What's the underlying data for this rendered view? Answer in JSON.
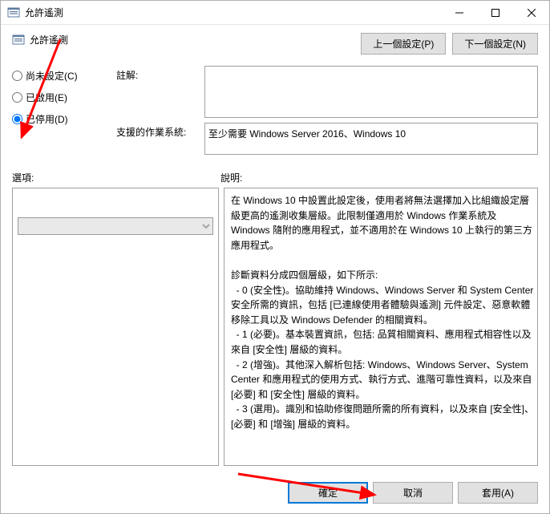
{
  "window": {
    "title": "允許遙測"
  },
  "header": {
    "policy_title": "允許遙測",
    "prev_button": "上一個設定(P)",
    "next_button": "下一個設定(N)"
  },
  "radios": {
    "not_configured": "尚未設定(C)",
    "enabled": "已啟用(E)",
    "disabled": "已停用(D)"
  },
  "fields": {
    "comment_label": "註解:",
    "comment_value": "",
    "os_label": "支援的作業系統:",
    "os_value": "至少需要 Windows Server 2016、Windows 10"
  },
  "labels": {
    "options": "選項:",
    "description": "說明:"
  },
  "options": {
    "selected": ""
  },
  "description_text": "在 Windows 10 中設置此設定後，使用者將無法選擇加入比組織設定層級更高的遙測收集層級。此限制僅適用於 Windows 作業系統及 Windows 隨附的應用程式，並不適用於在 Windows 10 上執行的第三方應用程式。\n\n診斷資料分成四個層級，如下所示:\n  - 0 (安全性)。協助維持 Windows、Windows Server 和 System Center 安全所需的資訊，包括 [已連線使用者體驗與遙測] 元件設定、惡意軟體移除工具以及 Windows Defender 的相關資料。\n  - 1 (必要)。基本裝置資訊，包括: 品質相關資料、應用程式相容性以及來自 [安全性] 層級的資料。\n  - 2 (增強)。其他深入解析包括: Windows、Windows Server、System Center 和應用程式的使用方式、執行方式、進階可靠性資料，以及來自 [必要] 和 [安全性] 層級的資料。\n  - 3 (選用)。識別和協助修復問題所需的所有資料，以及來自 [安全性]、[必要] 和 [增強] 層級的資料。",
  "buttons": {
    "ok": "確定",
    "cancel": "取消",
    "apply": "套用(A)"
  }
}
